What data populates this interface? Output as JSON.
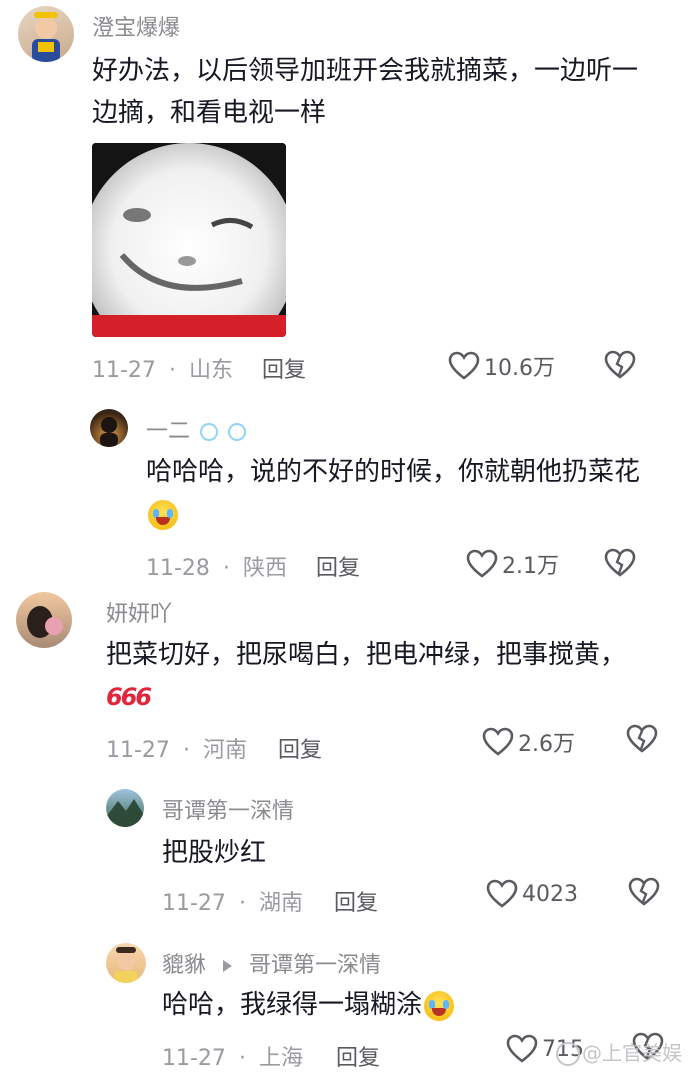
{
  "comments": [
    {
      "user": "澄宝爆爆",
      "text": "好办法，以后领导加班开会我就摘菜，一边听一边摘，和看电视一样",
      "date": "11-27",
      "location": "山东",
      "reply_label": "回复",
      "likes": "10.6万"
    },
    {
      "user": "一二",
      "text": "哈哈哈，说的不好的时候，你就朝他扔菜花",
      "date": "11-28",
      "location": "陕西",
      "reply_label": "回复",
      "likes": "2.1万"
    },
    {
      "user": "妍妍吖",
      "text": "把菜切好，把尿喝白，把电冲绿，把事搅黄，",
      "emoji_text": "666",
      "date": "11-27",
      "location": "河南",
      "reply_label": "回复",
      "likes": "2.6万"
    },
    {
      "user": "哥谭第一深情",
      "text": "把股炒红",
      "date": "11-27",
      "location": "湖南",
      "reply_label": "回复",
      "likes": "4023"
    },
    {
      "user": "貔貅",
      "reply_to": "哥谭第一深情",
      "text": "哈哈，我绿得一塌糊涂",
      "date": "11-27",
      "location": "上海",
      "reply_label": "回复",
      "likes": "715"
    }
  ],
  "separator": "·",
  "watermark": "@上官美娱",
  "icons": {
    "like": "heart-outline-icon",
    "dislike": "broken-heart-icon"
  }
}
